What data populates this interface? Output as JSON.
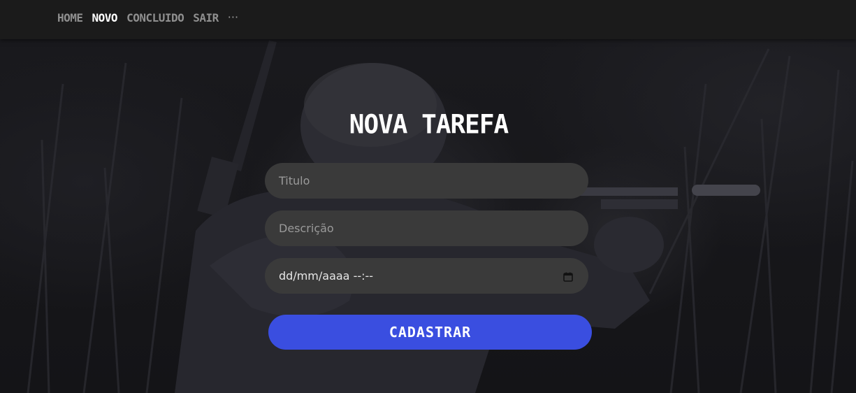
{
  "nav": {
    "items": [
      {
        "label": "HOME",
        "active": false
      },
      {
        "label": "NOVO",
        "active": true
      },
      {
        "label": "CONCLUIDO",
        "active": false
      },
      {
        "label": "SAIR",
        "active": false
      }
    ],
    "more_label": "···"
  },
  "form": {
    "title": "NOVA TAREFA",
    "titulo_placeholder": "Titulo",
    "descricao_placeholder": "Descrição",
    "date_value": "dd/mm/aaaa --:--",
    "submit_label": "CADASTRAR"
  },
  "colors": {
    "navbar": "#1b1b1b",
    "field": "#3a3a3a",
    "accent": "#3a4ee0",
    "active_nav": "#ffffff",
    "inactive_nav": "#8f8f8f"
  },
  "icons": {
    "date_picker": "calendar-icon",
    "more": "more-dots-icon"
  }
}
